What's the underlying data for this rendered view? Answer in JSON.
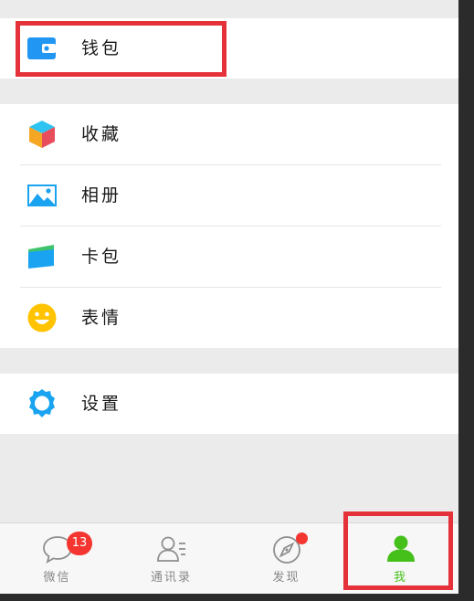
{
  "menu": {
    "wallet": {
      "label": "钱包",
      "icon": "wallet-icon"
    },
    "favorites": {
      "label": "收藏",
      "icon": "cube-icon"
    },
    "album": {
      "label": "相册",
      "icon": "picture-icon"
    },
    "cards": {
      "label": "卡包",
      "icon": "card-icon"
    },
    "stickers": {
      "label": "表情",
      "icon": "smiley-icon"
    },
    "settings": {
      "label": "设置",
      "icon": "gear-icon"
    }
  },
  "tabbar": {
    "tabs": [
      {
        "label": "微信",
        "icon": "chat-bubble-icon",
        "badge": "13"
      },
      {
        "label": "通讯录",
        "icon": "contacts-icon"
      },
      {
        "label": "发现",
        "icon": "compass-icon"
      },
      {
        "label": "我",
        "icon": "person-icon"
      }
    ],
    "active_tab": "我"
  },
  "colors": {
    "accent_green": "#45c01a",
    "wallet_blue": "#2196f3",
    "badge_red": "#f43530",
    "highlight_red": "#e5323a",
    "smiley_yellow": "#ffc300",
    "gear_blue": "#1aa3f0"
  }
}
